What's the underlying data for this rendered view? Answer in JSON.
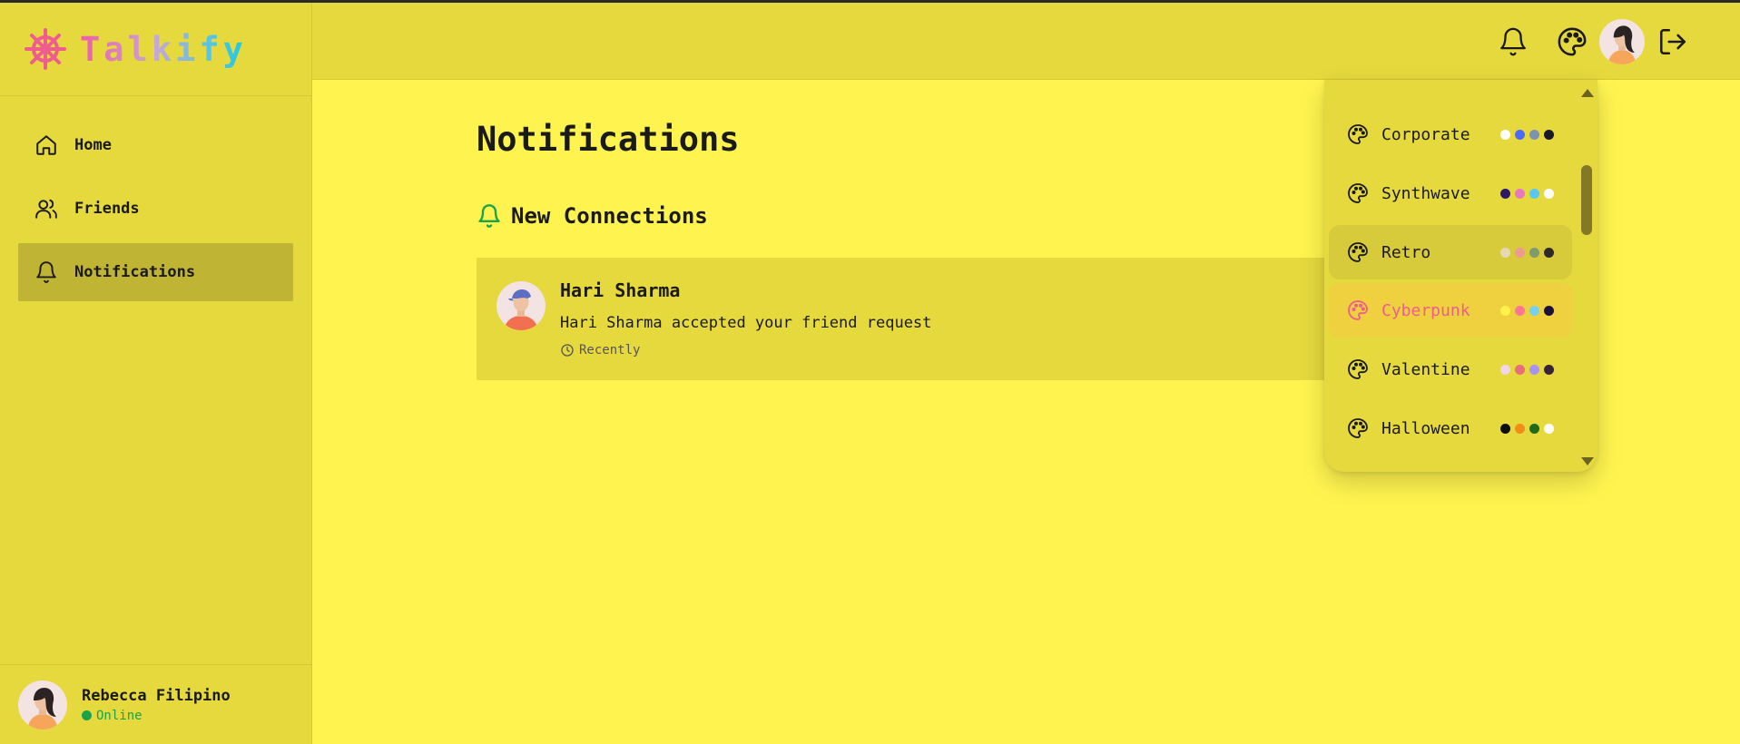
{
  "app": {
    "name": "Talkify"
  },
  "sidebar": {
    "items": [
      {
        "label": "Home",
        "icon": "home-icon"
      },
      {
        "label": "Friends",
        "icon": "users-icon"
      },
      {
        "label": "Notifications",
        "icon": "bell-icon",
        "active": true
      }
    ],
    "profile": {
      "name": "Rebecca Filipino",
      "status": "Online"
    }
  },
  "header": {
    "icons": [
      "bell-icon",
      "palette-icon",
      "avatar",
      "logout-icon"
    ]
  },
  "main": {
    "title": "Notifications",
    "section_title": "New Connections",
    "notifications": [
      {
        "name": "Hari Sharma",
        "message": "Hari Sharma accepted your friend request",
        "time": "Recently"
      }
    ]
  },
  "theme_dropdown": {
    "selected": "Cyberpunk",
    "themes": [
      {
        "name": "Corporate",
        "colors": [
          "#ffffff",
          "#4b6bfb",
          "#7b92b2",
          "#181a2a"
        ]
      },
      {
        "name": "Synthwave",
        "colors": [
          "#2d1b69",
          "#e779c1",
          "#58c7f3",
          "#ffffff"
        ]
      },
      {
        "name": "Retro",
        "colors": [
          "#e4d8b4",
          "#ef9995",
          "#7d9b6e",
          "#2e282a"
        ]
      },
      {
        "name": "Cyberpunk",
        "colors": [
          "#fff248",
          "#ff7598",
          "#75d1f0",
          "#1a103c"
        ]
      },
      {
        "name": "Valentine",
        "colors": [
          "#f0d6e8",
          "#e96d7b",
          "#a991f7",
          "#37243c"
        ]
      },
      {
        "name": "Halloween",
        "colors": [
          "#0d0d0d",
          "#f28c18",
          "#1e6b19",
          "#ffffff"
        ]
      }
    ]
  },
  "colors": {
    "background": "#fff44f",
    "surface": "#e6d93d",
    "accent_pink": "#ef5d8e",
    "online_green": "#1aa34a"
  }
}
